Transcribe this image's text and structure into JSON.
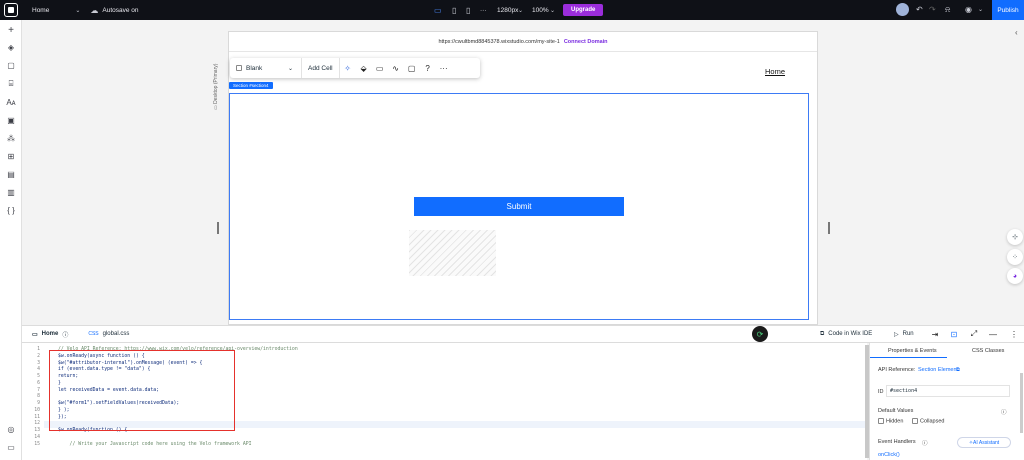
{
  "topbar": {
    "page_name": "Home",
    "autosave": "Autosave on",
    "dots": "···",
    "breakpoint": "1280px",
    "zoom": "100%",
    "upgrade_label": "Upgrade",
    "publish_label": "Publish"
  },
  "canvas": {
    "url": "https://cwultbmd8845378.wixstudio.com/my-site-1",
    "connect_domain": "Connect Domain",
    "desktop_label": "Desktop (Primary)",
    "home_link": "Home",
    "section_tag": "Section #section4",
    "submit_label": "Submit"
  },
  "toolbar": {
    "blank_label": "Blank",
    "add_cell_label": "Add Cell",
    "help": "?",
    "more": "···"
  },
  "panel": {
    "tab_home": "Home",
    "tab_global": "global.css",
    "code_in_ide": "Code in Wix IDE",
    "run_label": "Run"
  },
  "code": {
    "line_numbers": [
      "1",
      "2",
      "3",
      "4",
      "5",
      "6",
      "7",
      "8",
      "9",
      "10",
      "11",
      "12",
      "13",
      "14",
      "15"
    ],
    "lines": [
      "// Velo API Reference: https://www.wix.com/velo/reference/api-overview/introduction",
      "$w.onReady(async function () {",
      "$w(\"#attributor-internal\").onMessage( (event) => {",
      "if (event.data.type != \"data\") {",
      "return;",
      "}",
      "let receivedData = event.data.data;",
      "",
      "$w(\"#form1\").setFieldValues(receivedData);",
      "} );",
      "});",
      "",
      "$w.onReady(function () {",
      "",
      "    // Write your Javascript code here using the Velo framework API"
    ]
  },
  "right_panel": {
    "tab_properties": "Properties & Events",
    "tab_css": "CSS Classes",
    "api_ref_label": "API Reference:",
    "api_ref_link": "Section Element",
    "id_label": "ID",
    "id_value": "#section4",
    "default_values": "Default Values",
    "hidden_label": "Hidden",
    "collapsed_label": "Collapsed",
    "event_handlers": "Event Handlers",
    "ai_assistant": "AI Assistant",
    "onclick": "onClick()"
  },
  "colors": {
    "brand_blue": "#116dff",
    "upgrade_purple": "#9b2ddb",
    "highlight_red": "#e5312c"
  }
}
